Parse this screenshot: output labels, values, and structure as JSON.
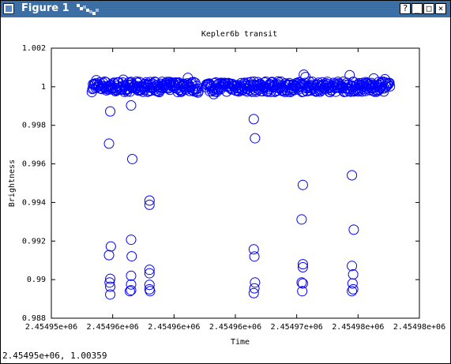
{
  "window": {
    "title": "Figure 1",
    "buttons": [
      {
        "name": "help",
        "glyph": "?"
      },
      {
        "name": "minimize",
        "glyph": "_"
      },
      {
        "name": "maximize",
        "glyph": "□"
      },
      {
        "name": "close",
        "glyph": "×"
      }
    ],
    "titlebar_color": "#3a6ea5"
  },
  "status": {
    "coordinates": "2.45495e+06,  1.00359"
  },
  "chart_data": {
    "type": "scatter",
    "title": "Kepler6b transit",
    "xlabel": "Time",
    "ylabel": "Brightness",
    "xlim": [
      2454950,
      2454980
    ],
    "ylim": [
      0.988,
      1.002
    ],
    "xticks": [
      "2.45495e+06",
      "2.45496e+06",
      "2.45496e+06",
      "2.45496e+06",
      "2.45497e+06",
      "2.45498e+06",
      "2.45498e+06"
    ],
    "yticks": [
      "1.002",
      "1",
      "0.998",
      "0.996",
      "0.994",
      "0.992",
      "0.99",
      "0.988"
    ],
    "grid": false,
    "marker": "open-circle",
    "color": "#0000ff",
    "baseline_bands": [
      {
        "x_start": 2454953.3,
        "x_end": 2454962.0,
        "y": 1.0
      },
      {
        "x_start": 2454962.6,
        "x_end": 2454977.6,
        "y": 1.0
      }
    ],
    "points": [
      [
        2454954.8,
        0.99872
      ],
      [
        2454954.7,
        0.99705
      ],
      [
        2454954.85,
        0.99172
      ],
      [
        2454954.7,
        0.99127
      ],
      [
        2454954.8,
        0.99004
      ],
      [
        2454954.75,
        0.98985
      ],
      [
        2454954.8,
        0.98963
      ],
      [
        2454954.8,
        0.98923
      ],
      [
        2454956.5,
        0.99903
      ],
      [
        2454956.6,
        0.99625
      ],
      [
        2454956.5,
        0.99207
      ],
      [
        2454956.55,
        0.99121
      ],
      [
        2454956.5,
        0.9902
      ],
      [
        2454956.5,
        0.98975
      ],
      [
        2454956.5,
        0.98945
      ],
      [
        2454956.4,
        0.9894
      ],
      [
        2454958.0,
        0.9941
      ],
      [
        2454958.0,
        0.99388
      ],
      [
        2454958.0,
        0.99051
      ],
      [
        2454958.0,
        0.99033
      ],
      [
        2454958.0,
        0.98973
      ],
      [
        2454958.0,
        0.9895
      ],
      [
        2454958.05,
        0.9894
      ],
      [
        2454966.5,
        0.99832
      ],
      [
        2454966.6,
        0.99733
      ],
      [
        2454966.5,
        0.99157
      ],
      [
        2454966.55,
        0.9912
      ],
      [
        2454966.6,
        0.98985
      ],
      [
        2454966.55,
        0.98955
      ],
      [
        2454966.5,
        0.9893
      ],
      [
        2454970.5,
        0.99491
      ],
      [
        2454970.4,
        0.99312
      ],
      [
        2454970.5,
        0.9908
      ],
      [
        2454970.5,
        0.99064
      ],
      [
        2454970.4,
        0.98985
      ],
      [
        2454970.5,
        0.9898
      ],
      [
        2454970.45,
        0.9894
      ],
      [
        2454974.5,
        0.99541
      ],
      [
        2454974.65,
        0.99259
      ],
      [
        2454974.5,
        0.99071
      ],
      [
        2454974.6,
        0.99027
      ],
      [
        2454974.55,
        0.9898
      ],
      [
        2454974.6,
        0.9895
      ],
      [
        2454974.5,
        0.9894
      ]
    ]
  }
}
